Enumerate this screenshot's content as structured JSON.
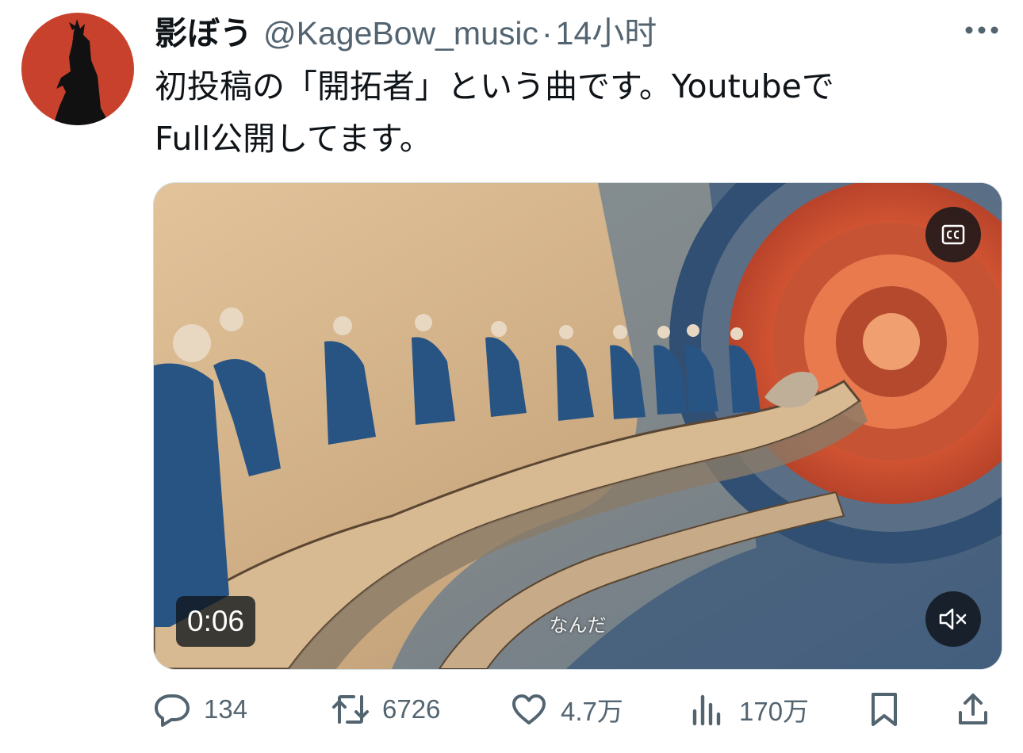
{
  "author": {
    "display_name": "影ぼう",
    "handle": "@KageBow_music",
    "separator": "·",
    "time": "14小时",
    "avatar_icon": "silhouette-avatar"
  },
  "tweet": {
    "text_line1": "初投稿の「開拓者」という曲です。Youtubeで",
    "text_line2": "Full公開してます。"
  },
  "video": {
    "timestamp": "0:06",
    "subtitle": "なんだ",
    "cc_icon": "closed-captions-icon",
    "mute_icon": "muted-speaker-icon"
  },
  "actions": {
    "replies": "134",
    "reposts": "6726",
    "likes": "4.7万",
    "views": "170万"
  },
  "colors": {
    "text": "#0f1419",
    "secondary": "#536471",
    "avatar_bg": "#c8412c",
    "robe_blue": "#2d5a88",
    "portal_orange": "#e5623a",
    "parchment": "#d9b98c"
  }
}
